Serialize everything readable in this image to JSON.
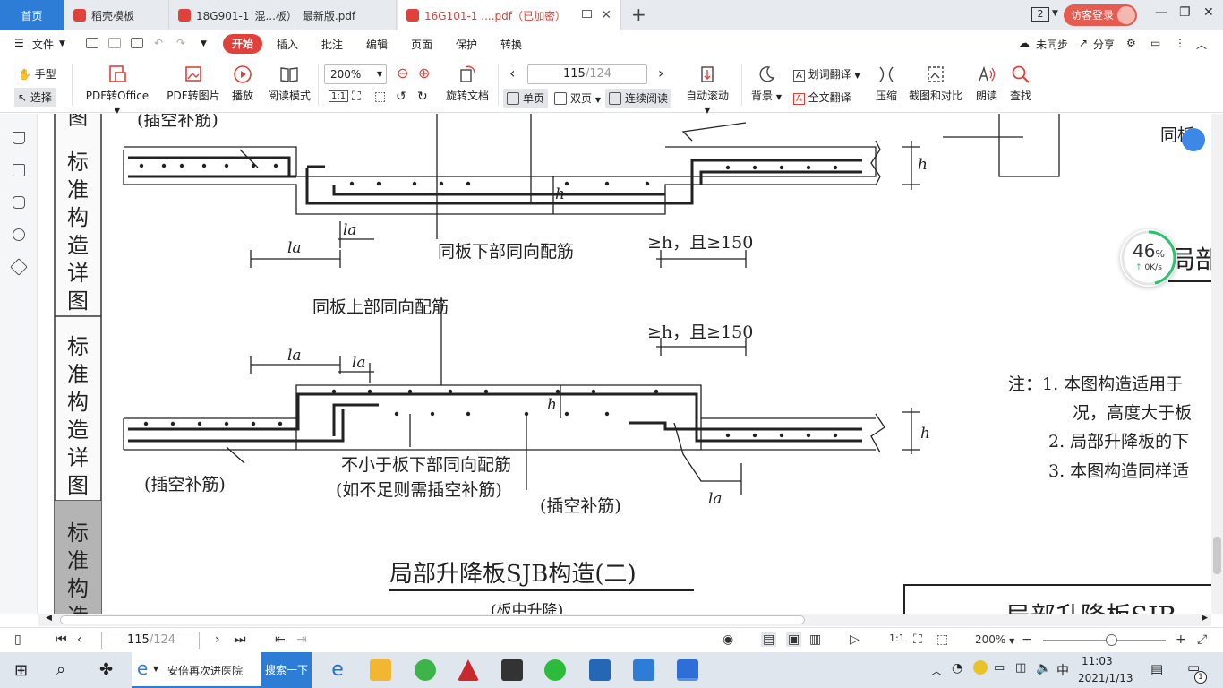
{
  "tabs": [
    {
      "label": "首页"
    },
    {
      "label": "稻壳模板"
    },
    {
      "label": "18G901-1_混...板）_最新版.pdf"
    },
    {
      "label": "16G101-1 ....pdf（已加密）"
    }
  ],
  "window": {
    "count": "2",
    "login": "访客登录"
  },
  "menu": {
    "file": "文件",
    "items": [
      "开始",
      "插入",
      "批注",
      "编辑",
      "页面",
      "保护",
      "转换"
    ],
    "sync": "未同步",
    "share": "分享"
  },
  "ribbon": {
    "hand": "手型",
    "select": "选择",
    "pdf_to_office": "PDF转Office",
    "pdf_to_image": "PDF转图片",
    "play": "播放",
    "read_mode": "阅读模式",
    "zoom": "200%",
    "rotate": "旋转文档",
    "page_current": "115",
    "page_total": "/124",
    "single": "单页",
    "double": "双页",
    "continuous": "连续阅读",
    "auto_scroll": "自动滚动",
    "background": "背景",
    "word_translate": "划词翻译",
    "full_translate": "全文翻译",
    "compress": "压缩",
    "screenshot_compare": "截图和对比",
    "read_aloud": "朗读",
    "find": "查找"
  },
  "document": {
    "side_labels": [
      "图",
      "标准构造详图",
      "标准构造详图",
      "标准构造"
    ],
    "top_label_insert": "(插空补筋)",
    "label_bottom_same": "同板下部同向配筋",
    "label_ge_h_1": "≥h，且≥150",
    "label_top_same": "同板上部同向配筋",
    "label_ge_h_2": "≥h，且≥150",
    "label_la": "la",
    "label_h": "h",
    "label_insert_left": "(插空补筋)",
    "label_min_bottom_1": "不小于板下部同向配筋",
    "label_min_bottom_2": "(如不足则需插空补筋)",
    "label_insert_mid": "(插空补筋)",
    "caption": "局部升降板SJB构造(二)",
    "sub_caption": "(板中升降)",
    "right_title_fragment": "局部",
    "right_bottom_fragment": "局部升降板SJB",
    "right_top_fragment": "同板",
    "note_1a": "注：1. 本图构造适用于",
    "note_1b": "况，高度大于板",
    "note_2": "2. 局部升降板的下",
    "note_3": "3. 本图构造同样适"
  },
  "speed_widget": {
    "percent": "46",
    "unit": "%",
    "rate": "0K/s"
  },
  "status": {
    "page_current": "115",
    "page_total": "/124",
    "zoom": "200%"
  },
  "taskbar": {
    "browser_title": "安倍再次进医院",
    "search": "搜索一下",
    "ime": "中",
    "time": "11:03",
    "date": "2021/1/13",
    "notification_count": "1"
  },
  "colors": {
    "accent": "#2d7cd6",
    "start": "#e0413a",
    "login": "#e65a4f"
  }
}
